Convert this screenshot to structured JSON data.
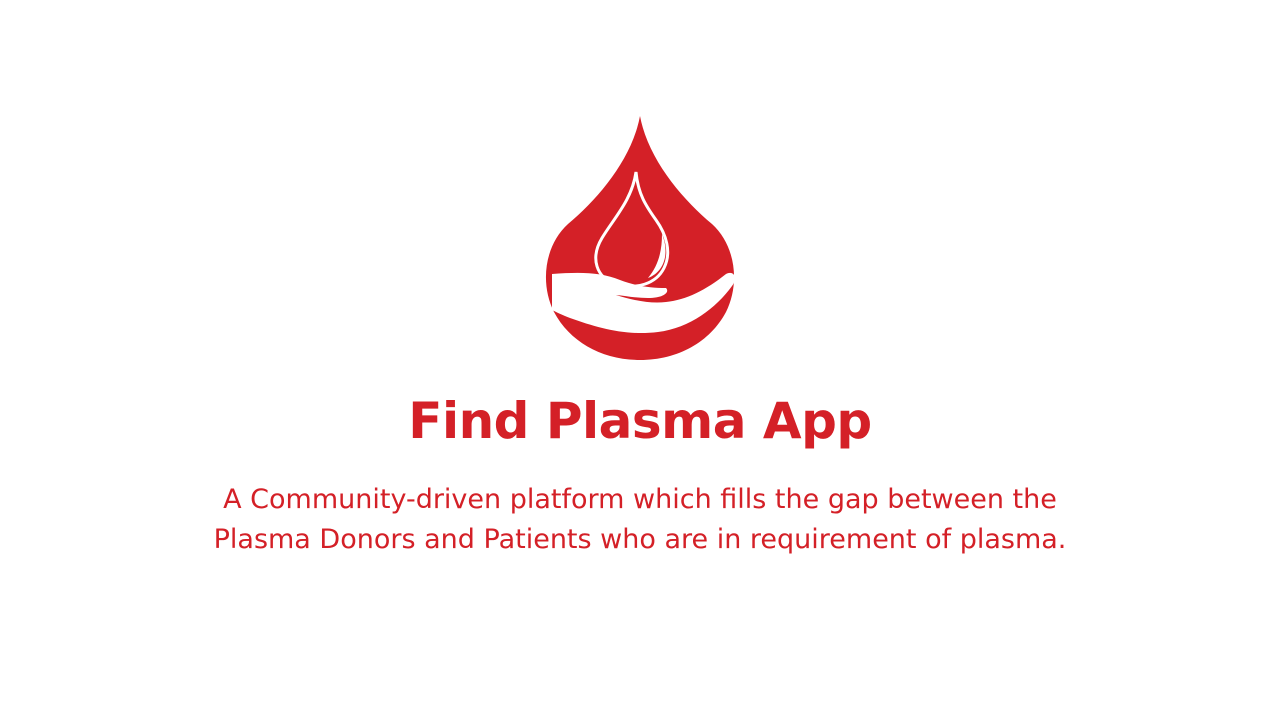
{
  "brand": {
    "logo_icon": "blood-drop-hand-icon",
    "accent_color": "#d42027",
    "title": "Find Plasma App",
    "tagline_line1": "A Community-driven platform which fills the gap between the",
    "tagline_line2": "Plasma Donors and Patients who are in requirement of plasma."
  }
}
